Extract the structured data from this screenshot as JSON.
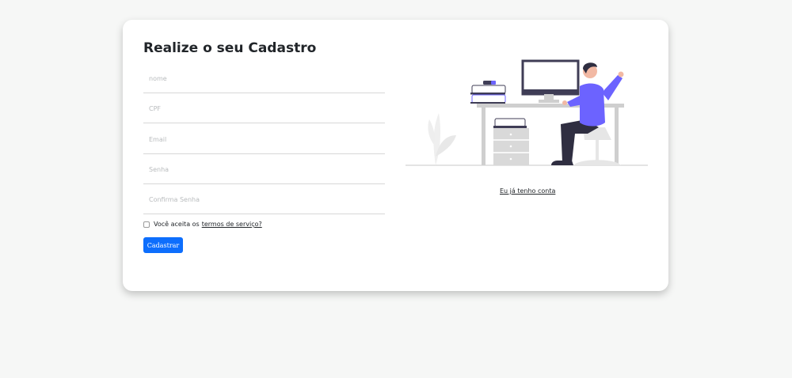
{
  "form": {
    "title": "Realize o seu Cadastro",
    "fields": [
      {
        "name": "nome",
        "placeholder": "nome",
        "value": ""
      },
      {
        "name": "cpf",
        "placeholder": "CPF",
        "value": ""
      },
      {
        "name": "email",
        "placeholder": "Email",
        "value": ""
      },
      {
        "name": "senha",
        "placeholder": "Senha",
        "value": ""
      },
      {
        "name": "confirma-senha",
        "placeholder": "Confirma Senha",
        "value": ""
      }
    ],
    "terms_prefix": "Você aceita os",
    "terms_link": "termos de serviço?",
    "terms_checked": false,
    "submit_label": "Cadastrar"
  },
  "side": {
    "login_link": "Eu já tenho conta",
    "illustration": "person-at-desk-illustration"
  },
  "colors": {
    "background": "#f6f7f6",
    "card": "#ffffff",
    "primary_button": "#0d6efd",
    "illustration_accent": "#6c63ff",
    "illustration_dark": "#2f2e41"
  }
}
